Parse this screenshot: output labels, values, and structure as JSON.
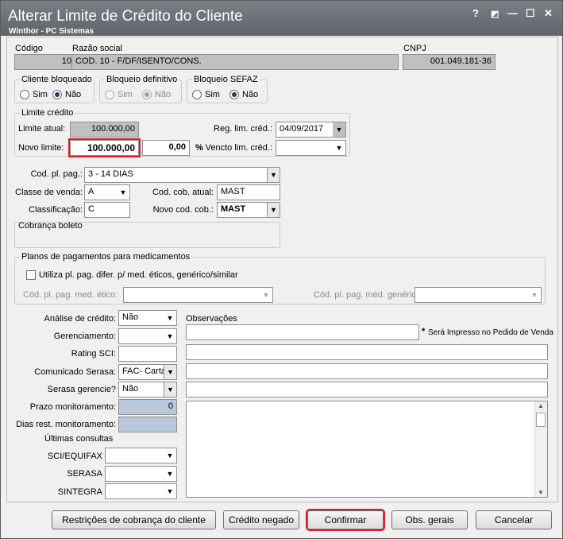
{
  "window": {
    "title": "Alterar Limite de Crédito do Cliente",
    "subtitle": "Winthor - PC Sistemas",
    "help": "?",
    "minimize": "—",
    "maximize": "☐",
    "close": "✕"
  },
  "client": {
    "codigo_label": "Código",
    "codigo": "10",
    "razao_label": "Razão social",
    "razao": "COD. 10 - F/DF/ISENTO/CONS.",
    "cnpj_label": "CNPJ",
    "cnpj": "001.049.181-36"
  },
  "groups": {
    "cliente_bloqueado": {
      "label": "Cliente bloqueado",
      "sim": "Sim",
      "nao": "Não"
    },
    "bloqueio_definitivo": {
      "label": "Bloqueio definitivo",
      "sim": "Sim",
      "nao": "Não"
    },
    "bloqueio_sefaz": {
      "label": "Bloqueio SEFAZ",
      "sim": "Sim",
      "nao": "Não"
    }
  },
  "limite": {
    "group_label": "Limite crédito",
    "atual_label": "Limite atual:",
    "atual": "100.000,00",
    "novo_label": "Novo limite:",
    "novo": "100.000,00",
    "percent": "0,00",
    "percent_sign": "%",
    "reg_label": "Reg. lim. créd.:",
    "reg": "04/09/2017",
    "vencto_label": "Vencto lim. créd.:",
    "vencto": ""
  },
  "pagamento": {
    "cod_pl_label": "Cod. pl. pag.:",
    "cod_pl": "3 - 14 DIAS",
    "classe_label": "Classe de venda:",
    "classe": "A",
    "cob_atual_label": "Cod. cob. atual:",
    "cob_atual": "MAST",
    "classif_label": "Classificação:",
    "classif": "C",
    "novo_cob_label": "Novo cod. cob.:",
    "novo_cob": "MAST",
    "boleto_label": "Cobrança boleto"
  },
  "planos": {
    "group_label": "Planos de pagamentos para medicamentos",
    "check_label": "Utiliza pl. pag. difer. p/ med. éticos, genérico/similar",
    "etico_label": "Cód. pl. pag. med. ético:",
    "generico_label": "Cód. pl. pag. méd. genérico:"
  },
  "analise": {
    "analise_label": "Análise de crédito:",
    "analise": "Não",
    "gerenciamento_label": "Gerenciamento:",
    "gerenciamento": "",
    "rating_label": "Rating SCI:",
    "rating": "",
    "comunicado_label": "Comunicado Serasa:",
    "comunicado": "FAC- Carta",
    "serasa_ger_label": "Serasa gerencie?",
    "serasa_ger": "Não",
    "prazo_label": "Prazo monitoramento:",
    "prazo": "0",
    "dias_label": "Dias rest. monitoramento:",
    "dias": "",
    "ultimas_label": "Últimas consultas",
    "sci_label": "SCI/EQUIFAX",
    "serasa_label": "SERASA",
    "sintegra_label": "SINTEGRA"
  },
  "observacoes": {
    "label": "Observações",
    "note_star": "*",
    "note": "Será Impresso no Pedido de Venda"
  },
  "buttons": {
    "restricoes": "Restrições de cobrança do cliente",
    "credito_negado": "Crédito negado",
    "confirmar": "Confirmar",
    "obs_gerais": "Obs. gerais",
    "cancelar": "Cancelar"
  },
  "icons": {
    "dropdown": "▼",
    "scroll_up": "▲",
    "scroll_down": "▼"
  }
}
